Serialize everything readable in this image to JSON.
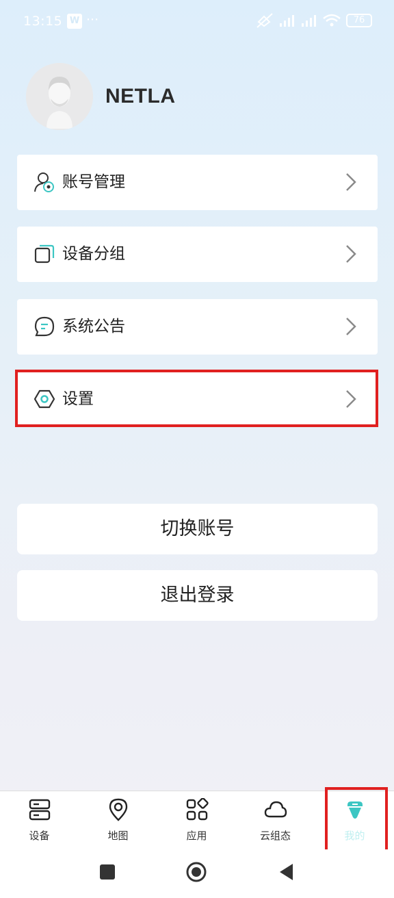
{
  "status_bar": {
    "time": "13:15",
    "app_badge": "W",
    "dots": "···",
    "battery": "76"
  },
  "profile": {
    "username": "NETLA"
  },
  "menu": [
    {
      "label": "账号管理",
      "icon": "account-manage-icon"
    },
    {
      "label": "设备分组",
      "icon": "device-group-icon"
    },
    {
      "label": "系统公告",
      "icon": "announcement-icon"
    },
    {
      "label": "设置",
      "icon": "settings-icon"
    }
  ],
  "actions": {
    "switch_account": "切换账号",
    "logout": "退出登录"
  },
  "tabs": [
    {
      "label": "设备",
      "icon": "device-icon"
    },
    {
      "label": "地图",
      "icon": "map-pin-icon"
    },
    {
      "label": "应用",
      "icon": "apps-icon"
    },
    {
      "label": "云组态",
      "icon": "cloud-icon"
    },
    {
      "label": "我的",
      "icon": "profile-icon",
      "active": true
    }
  ],
  "colors": {
    "accent": "#3cc6c3",
    "highlight": "#e02020",
    "active_tab_label": "#bfeff0"
  }
}
